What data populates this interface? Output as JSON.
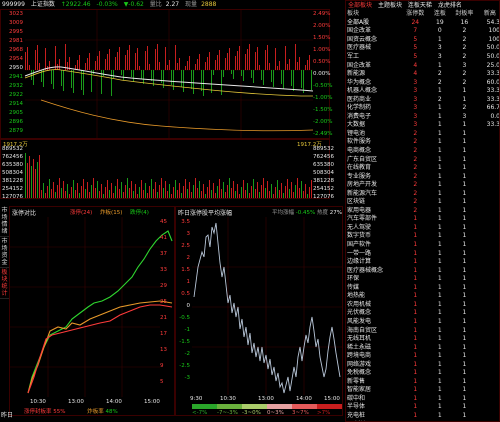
{
  "index": {
    "code": "999999",
    "name": "上证指数",
    "price_label": "↑2922.46",
    "change": "-0.03%",
    "change2": "▼-0.62",
    "volume_label": "量比",
    "volume_value": "2.27",
    "amount_label": "现量",
    "amount_value": "2888",
    "y_left": [
      "3023",
      "3009",
      "2995",
      "2981",
      "2968",
      "2954",
      "2950",
      "2940",
      "2926",
      "2912",
      "2898",
      "2884",
      "2871",
      "2857"
    ],
    "y_left2": [
      "2950",
      "2941",
      "2932",
      "2922",
      "2914",
      "2905",
      "2896",
      "2887",
      "2879"
    ],
    "y_right": [
      "2.49%",
      "2.00%",
      "1.50%",
      "1.00%",
      "0.50%",
      "0.00%",
      "-0.50%",
      "-1.00%",
      "-1.50%",
      "-2.00%",
      "-2.49%"
    ],
    "ma_left": "1917.2万",
    "ma_right": "1917.2万",
    "vol_ticks": [
      "889532",
      "762456",
      "635380",
      "508304",
      "381228",
      "254152",
      "127076"
    ],
    "vol_ticks_r": [
      "889532",
      "762456",
      "635380",
      "508304",
      "381228",
      "254152",
      "127076"
    ]
  },
  "side_tabs": [
    "市场情绪",
    "市场资金",
    "板块统计",
    "涨停分析"
  ],
  "breadth": {
    "tab_left": "涨停对比",
    "legend": [
      "涨停(24)",
      "炸板(15)",
      "跌停(4)"
    ],
    "y_right": [
      "45",
      "41",
      "37",
      "33",
      "29",
      "25",
      "21",
      "17",
      "13",
      "9",
      "5"
    ],
    "x_ticks": [
      "10:30",
      "13:00",
      "14:00",
      "15:00"
    ],
    "footer_label": "涨停封板率",
    "footer_value": "55%",
    "footer2_label": "炸板率",
    "footer2_value": "48%"
  },
  "perf": {
    "title": "昨日涨停股平均涨幅",
    "avg_label": "平均涨幅",
    "avg_value": "-0.45%",
    "heat_label": "热度",
    "heat_value": "27%",
    "y_left": [
      "3.5",
      "3",
      "2.5",
      "2",
      "1.5",
      "1",
      "0.5",
      "0",
      "-0.5",
      "-1",
      "-1.5",
      "-2",
      "-2.5",
      "-3"
    ],
    "x_ticks": [
      "9:30",
      "10:30",
      "13:00",
      "14:00",
      "15:00"
    ],
    "dist_labels": [
      "<-7%",
      "-7~-3%",
      "-3~0%",
      "0~3%",
      "3~7%",
      ">7%"
    ],
    "dist_colors": [
      "#2aa62a",
      "#6ab03c",
      "#aacc6a",
      "#e5a0a0",
      "#e55a5a",
      "#c81e1e"
    ]
  },
  "ranking": {
    "tabs": [
      "全部板块",
      "主题板块",
      "连板天梯",
      "龙虎排名"
    ],
    "headers": [
      "板块",
      "涨停数",
      "连板",
      "封板率",
      "新高"
    ],
    "col1_color": "#ff3b3b",
    "rows": [
      {
        "name": "全部A股",
        "c1": "24",
        "c2": "19",
        "c3": "16",
        "c4": "54.3"
      },
      {
        "name": "国企改革",
        "c1": "7",
        "c2": "0",
        "c3": "2",
        "c4": "100"
      },
      {
        "name": "国资云概念",
        "c1": "5",
        "c2": "1",
        "c3": "2",
        "c4": "100"
      },
      {
        "name": "医疗器械",
        "c1": "5",
        "c2": "3",
        "c3": "2",
        "c4": "50.0"
      },
      {
        "name": "军工",
        "c1": "5",
        "c2": "3",
        "c3": "2",
        "c4": "50.0"
      },
      {
        "name": "国企改革",
        "c1": "4",
        "c2": "1",
        "c3": "3",
        "c4": "25.0"
      },
      {
        "name": "新能源",
        "c1": "4",
        "c2": "2",
        "c3": "2",
        "c4": "33.3"
      },
      {
        "name": "华为概念",
        "c1": "3",
        "c2": "2",
        "c3": "2",
        "c4": "60.0"
      },
      {
        "name": "机器人概念",
        "c1": "3",
        "c2": "1",
        "c3": "1",
        "c4": "33.3"
      },
      {
        "name": "医药商业",
        "c1": "3",
        "c2": "2",
        "c3": "1",
        "c4": "33.3"
      },
      {
        "name": "化学制药",
        "c1": "3",
        "c2": "1",
        "c3": "2",
        "c4": "66.7"
      },
      {
        "name": "消费电子",
        "c1": "3",
        "c2": "1",
        "c3": "3",
        "c4": "0.0"
      },
      {
        "name": "大数据",
        "c1": "3",
        "c2": "1",
        "c3": "1",
        "c4": "33.3"
      },
      {
        "name": "锂电池",
        "c1": "2",
        "c2": "1",
        "c3": "1",
        "c4": ""
      },
      {
        "name": "软件服务",
        "c1": "2",
        "c2": "1",
        "c3": "1",
        "c4": ""
      },
      {
        "name": "电商概念",
        "c1": "2",
        "c2": "1",
        "c3": "1",
        "c4": ""
      },
      {
        "name": "广东自贸区",
        "c1": "2",
        "c2": "1",
        "c3": "1",
        "c4": ""
      },
      {
        "name": "在线教育",
        "c1": "2",
        "c2": "1",
        "c3": "1",
        "c4": ""
      },
      {
        "name": "专业服务",
        "c1": "2",
        "c2": "1",
        "c3": "1",
        "c4": ""
      },
      {
        "name": "房地产开发",
        "c1": "2",
        "c2": "1",
        "c3": "1",
        "c4": ""
      },
      {
        "name": "新能源汽车",
        "c1": "2",
        "c2": "1",
        "c3": "1",
        "c4": ""
      },
      {
        "name": "区块链",
        "c1": "2",
        "c2": "1",
        "c3": "1",
        "c4": ""
      },
      {
        "name": "家用电器",
        "c1": "2",
        "c2": "1",
        "c3": "1",
        "c4": ""
      },
      {
        "name": "汽车零部件",
        "c1": "1",
        "c2": "1",
        "c3": "1",
        "c4": ""
      },
      {
        "name": "无人驾驶",
        "c1": "1",
        "c2": "1",
        "c3": "1",
        "c4": ""
      },
      {
        "name": "数字货币",
        "c1": "1",
        "c2": "1",
        "c3": "1",
        "c4": ""
      },
      {
        "name": "国产软件",
        "c1": "1",
        "c2": "1",
        "c3": "1",
        "c4": ""
      },
      {
        "name": "一带一路",
        "c1": "1",
        "c2": "1",
        "c3": "1",
        "c4": ""
      },
      {
        "name": "边缘计算",
        "c1": "1",
        "c2": "1",
        "c3": "1",
        "c4": ""
      },
      {
        "name": "医疗器械概念",
        "c1": "1",
        "c2": "1",
        "c3": "1",
        "c4": ""
      },
      {
        "name": "环保",
        "c1": "1",
        "c2": "1",
        "c3": "1",
        "c4": ""
      },
      {
        "name": "传媒",
        "c1": "1",
        "c2": "1",
        "c3": "1",
        "c4": ""
      },
      {
        "name": "地热能",
        "c1": "1",
        "c2": "1",
        "c3": "1",
        "c4": ""
      },
      {
        "name": "农用机械",
        "c1": "1",
        "c2": "1",
        "c3": "1",
        "c4": ""
      },
      {
        "name": "光伏概念",
        "c1": "1",
        "c2": "1",
        "c3": "1",
        "c4": ""
      },
      {
        "name": "风能发电",
        "c1": "1",
        "c2": "1",
        "c3": "1",
        "c4": ""
      },
      {
        "name": "海南自贸区",
        "c1": "1",
        "c2": "1",
        "c3": "1",
        "c4": ""
      },
      {
        "name": "无线耳机",
        "c1": "1",
        "c2": "1",
        "c3": "1",
        "c4": ""
      },
      {
        "name": "稀土永磁",
        "c1": "1",
        "c2": "1",
        "c3": "1",
        "c4": ""
      },
      {
        "name": "跨境电商",
        "c1": "1",
        "c2": "1",
        "c3": "1",
        "c4": ""
      },
      {
        "name": "网络游戏",
        "c1": "1",
        "c2": "1",
        "c3": "1",
        "c4": ""
      },
      {
        "name": "免税概念",
        "c1": "1",
        "c2": "1",
        "c3": "1",
        "c4": ""
      },
      {
        "name": "新零售",
        "c1": "1",
        "c2": "1",
        "c3": "1",
        "c4": ""
      },
      {
        "name": "智能家居",
        "c1": "1",
        "c2": "1",
        "c3": "1",
        "c4": ""
      },
      {
        "name": "碳中和",
        "c1": "1",
        "c2": "1",
        "c3": "1",
        "c4": ""
      },
      {
        "name": "半导体",
        "c1": "1",
        "c2": "1",
        "c3": "1",
        "c4": ""
      },
      {
        "name": "充电桩",
        "c1": "1",
        "c2": "1",
        "c3": "1",
        "c4": ""
      },
      {
        "name": "ST板块",
        "c1": "1",
        "c2": "1",
        "c3": "1",
        "c4": ""
      }
    ]
  },
  "bottom_tab": "昨日"
}
